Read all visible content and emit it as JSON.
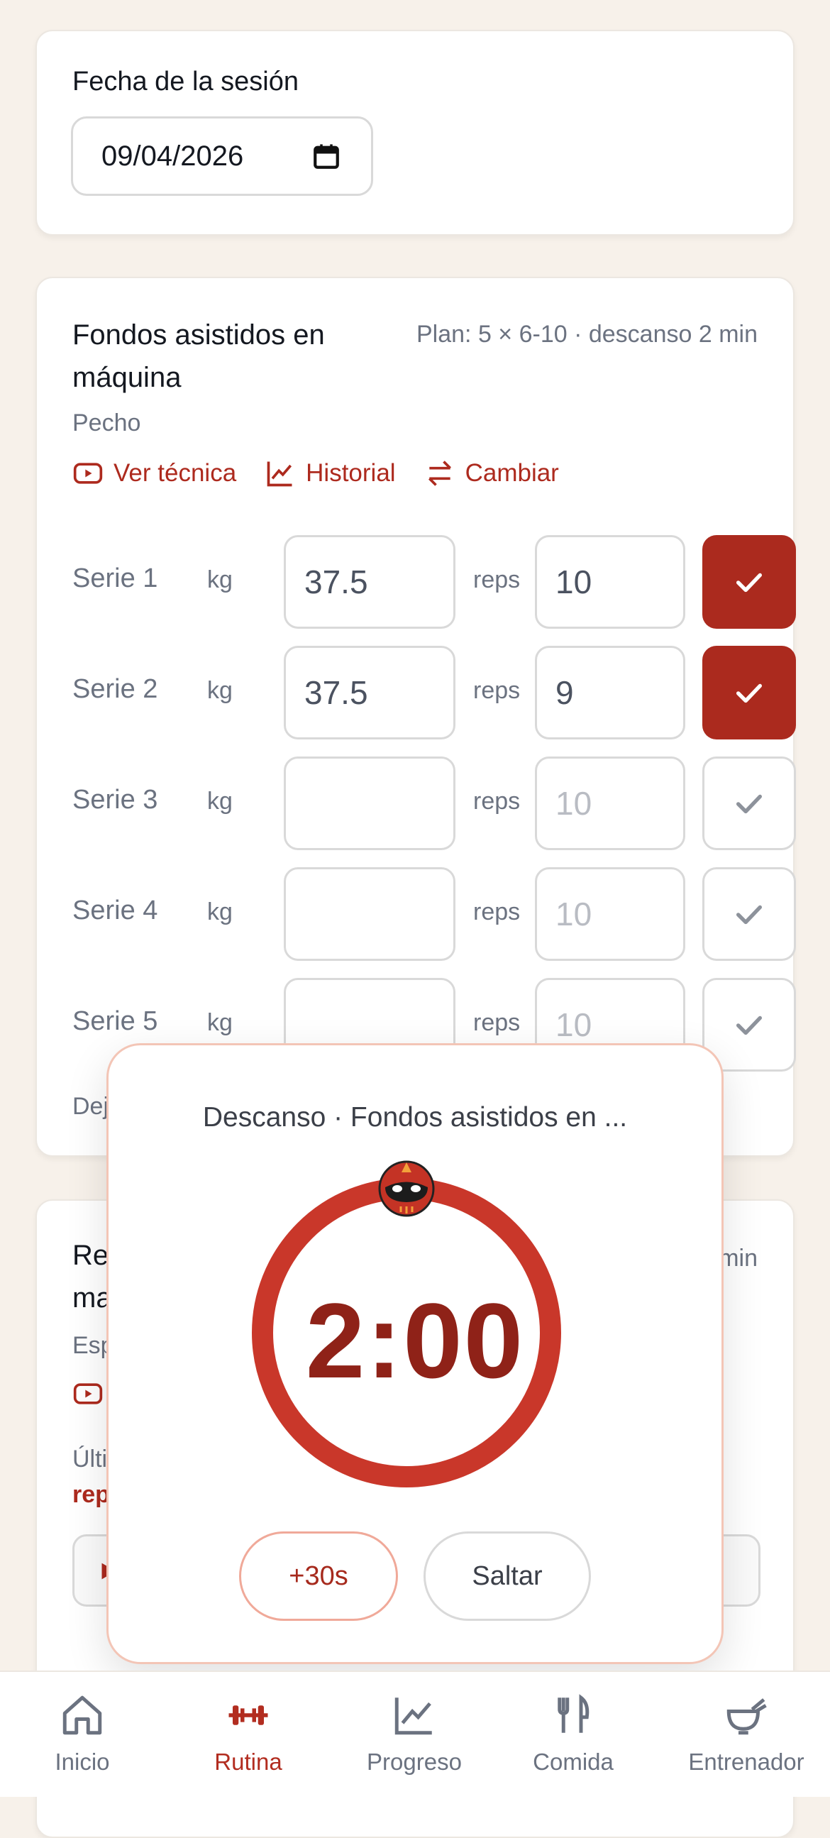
{
  "session": {
    "date_label": "Fecha de la sesión",
    "date_value": "09/04/2026"
  },
  "exercise1": {
    "title": "Fondos asistidos en máquina",
    "plan": "Plan: 5 × 6-10 · descanso 2 min",
    "muscle": "Pecho",
    "links": {
      "technique": "Ver técnica",
      "history": "Historial",
      "swap": "Cambiar"
    },
    "kg_unit": "kg",
    "reps_unit": "reps",
    "sets": [
      {
        "label": "Serie 1",
        "kg": "37.5",
        "reps": "10",
        "reps_placeholder": "",
        "done": true
      },
      {
        "label": "Serie 2",
        "kg": "37.5",
        "reps": "9",
        "reps_placeholder": "",
        "done": true
      },
      {
        "label": "Serie 3",
        "kg": "",
        "reps": "",
        "reps_placeholder": "10",
        "done": false
      },
      {
        "label": "Serie 4",
        "kg": "",
        "reps": "",
        "reps_placeholder": "10",
        "done": false
      },
      {
        "label": "Serie 5",
        "kg": "",
        "reps": "",
        "reps_placeholder": "10",
        "done": false
      }
    ],
    "footer_partial": "Dej"
  },
  "exercise2_partial": {
    "title_fragment_1": "Re",
    "title_fragment_2": "ma",
    "plan_fragment": "min",
    "muscle_fragment": "Esp",
    "last_fragment": "Últi",
    "reps_fragment": "rep"
  },
  "rest_timer": {
    "title": "Descanso · Fondos asistidos en ...",
    "time": "2:00",
    "add_label": "+30s",
    "skip_label": "Saltar",
    "progress": 1.0
  },
  "nav": {
    "items": [
      {
        "label": "Inicio",
        "icon": "home-icon",
        "active": false
      },
      {
        "label": "Rutina",
        "icon": "dumbbell-icon",
        "active": true
      },
      {
        "label": "Progreso",
        "icon": "chart-icon",
        "active": false
      },
      {
        "label": "Comida",
        "icon": "fork-knife-icon",
        "active": false
      },
      {
        "label": "Entrenador",
        "icon": "coach-icon",
        "active": false
      }
    ]
  },
  "colors": {
    "accent": "#ab2a1e",
    "ring": "#c9372a",
    "time": "#8f2218",
    "background": "#f7f1ea"
  }
}
